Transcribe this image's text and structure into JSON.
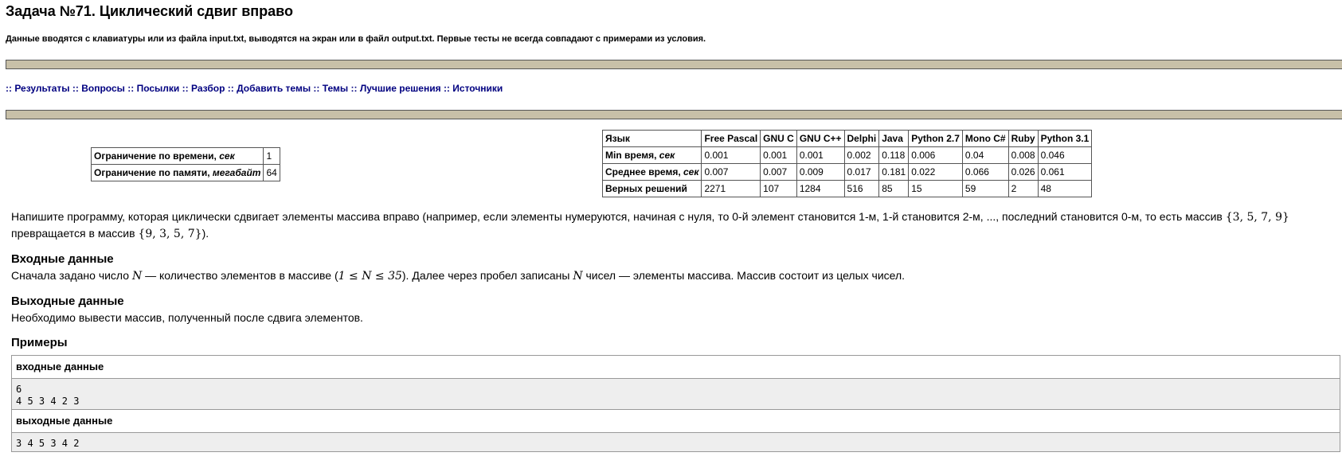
{
  "page": {
    "title": "Задача №71. Циклический сдвиг вправо",
    "io_note": "Данные вводятся с клавиатуры или из файла input.txt, выводятся на экран или в файл output.txt. Первые тесты не всегда совпадают с примерами из условия."
  },
  "nav": {
    "separator": "::",
    "items": [
      "Результаты",
      "Вопросы",
      "Посылки",
      "Разбор",
      "Добавить темы",
      "Темы",
      "Лучшие решения",
      "Источники"
    ]
  },
  "limits": {
    "time_label": "Ограничение по времени, ",
    "time_unit": "сек",
    "time_value": "1",
    "memory_label": "Ограничение по памяти, ",
    "memory_unit": "мегабайт",
    "memory_value": "64"
  },
  "stats": {
    "header": [
      "Язык",
      "Free Pascal",
      "GNU C",
      "GNU C++",
      "Delphi",
      "Java",
      "Python 2.7",
      "Mono C#",
      "Ruby",
      "Python 3.1"
    ],
    "rows": [
      {
        "label": "Min время, ",
        "unit": "сек",
        "values": [
          "0.001",
          "0.001",
          "0.001",
          "0.002",
          "0.118",
          "0.006",
          "0.04",
          "0.008",
          "0.046"
        ]
      },
      {
        "label": "Среднее время, ",
        "unit": "сек",
        "values": [
          "0.007",
          "0.007",
          "0.009",
          "0.017",
          "0.181",
          "0.022",
          "0.066",
          "0.026",
          "0.061"
        ]
      },
      {
        "label": "Верных решений",
        "unit": "",
        "values": [
          "2271",
          "107",
          "1284",
          "516",
          "85",
          "15",
          "59",
          "2",
          "48"
        ]
      }
    ]
  },
  "statement": {
    "text_1": "Напишите программу, которая циклически сдвигает элементы массива вправо (например, если элементы нумеруются, начиная с нуля, то 0-й элемент становится 1-м, 1-й становится 2-м, ..., последний становится 0-м, то есть массив ",
    "array_before": "{3, 5, 7, 9}",
    "text_2": " превращается в массив ",
    "array_after": "{9, 3, 5, 7}",
    "text_3": ").",
    "input_heading": "Входные данные",
    "input_text_1": "Сначала задано число ",
    "input_var_n": "N",
    "input_text_2": " — количество элементов в массиве (",
    "input_constraint": "1 ≤ N ≤ 35",
    "input_text_3": "). Далее через пробел записаны ",
    "input_var_n2": "N",
    "input_text_4": " чисел — элементы массива. Массив состоит из целых чисел.",
    "output_heading": "Выходные данные",
    "output_text": "Необходимо вывести массив, полученный после сдвига элементов.",
    "examples_heading": "Примеры"
  },
  "examples": {
    "input_label": "входные данные",
    "input_lines": [
      "6",
      "4 5 3 4 2 3"
    ],
    "output_label": "выходные данные",
    "output_lines": [
      "3 4 5 3 4 2"
    ]
  }
}
